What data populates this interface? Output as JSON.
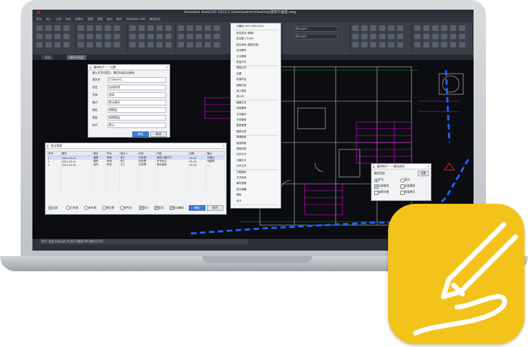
{
  "window": {
    "title": "Autodesk AutoCAD 2013  C:\\Users\\admin\\Desktop\\建筑平面图.dwg",
    "tabs": [
      "开始",
      "建筑平面图"
    ]
  },
  "ribbon": {
    "tabs": [
      "默认",
      "插入",
      "注释",
      "布局",
      "参数化",
      "视图",
      "管理",
      "输出",
      "插件",
      "Autodesk 360",
      "精选应用"
    ]
  },
  "layer_combo": "ByLayer",
  "ctx_menu": {
    "header": "已翻译 165 (330/1001)",
    "items": [
      "批注发言 (图框)",
      "批注图 (CCAD)",
      "批注添加 (图层信息)",
      "自动编号",
      "文字替换",
      "批量打印",
      "图纸比对",
      "设置",
      "批量导出",
      "提取内容",
      "插入属性",
      "插入块",
      "编辑文字",
      "查找替换",
      "文字格式",
      "字体替换",
      "图层管理",
      "图层过滤",
      "清理图纸",
      "核查修复",
      "图纸信息",
      "合并文字",
      "分解文字",
      "对齐文字",
      "打断图块",
      "文字排序",
      "编号递增",
      "显示隐藏",
      "帮助",
      "关于"
    ]
  },
  "dialog_config": {
    "title": "翻译助手——设置",
    "prompt": "输入文字内容后，按回车或点击查询",
    "fields": [
      {
        "label": "源文件",
        "value": "C:\\Users\\..."
      },
      {
        "label": "语言",
        "value": "自动检测"
      },
      {
        "label": "字体",
        "value": "宋体"
      },
      {
        "label": "格式",
        "value": "默认格式"
      },
      {
        "label": "颜色",
        "value": "随图层"
      },
      {
        "label": "图层",
        "value": "新建图层"
      },
      {
        "label": "样式",
        "value": "默认"
      }
    ],
    "ok": "确定",
    "cancel": "取消"
  },
  "dialog_table": {
    "title": "批注管理",
    "columns": [
      "序号",
      "图号",
      "图名",
      "专业",
      "批注人",
      "状态",
      "内容",
      "日期",
      "备注"
    ],
    "rows": [
      [
        "1",
        "2022-03-01",
        "建筑",
        "审核",
        "张工",
        "已处理",
        "修改门窗尺寸",
        "03-02",
        "已确认"
      ],
      [
        "2",
        "2022-03-01",
        "建筑",
        "审核",
        "李工",
        "待处理",
        "补充标注",
        "03-03",
        "待复核"
      ],
      [
        "3",
        "2022-03-02",
        "结构",
        "审定",
        "王工",
        "已处理",
        "核对梁高",
        "03-04",
        "—"
      ]
    ],
    "options": [
      "全部",
      "已处理",
      "未处理",
      "按日期",
      "按专业"
    ],
    "checks": [
      "显示",
      "定位",
      "自动编号"
    ],
    "ok": "确定",
    "cancel": "取消"
  },
  "dialog_small": {
    "title": "翻译助手——翻译选项",
    "btn": "设置",
    "labels": [
      "翻译范围",
      "中文",
      "英文",
      "当前图纸",
      "全部图纸",
      "选择对象",
      "保留原文"
    ]
  },
  "command_line": "命令: 指定对角点或 [栏选(F)/圈围(WP)/圈交(CP)]:",
  "colors": {
    "accent": "#f2c31b",
    "magenta": "#ff00ff",
    "cad_bg": "#0b0d10",
    "dash_blue": "#1f62ff"
  }
}
